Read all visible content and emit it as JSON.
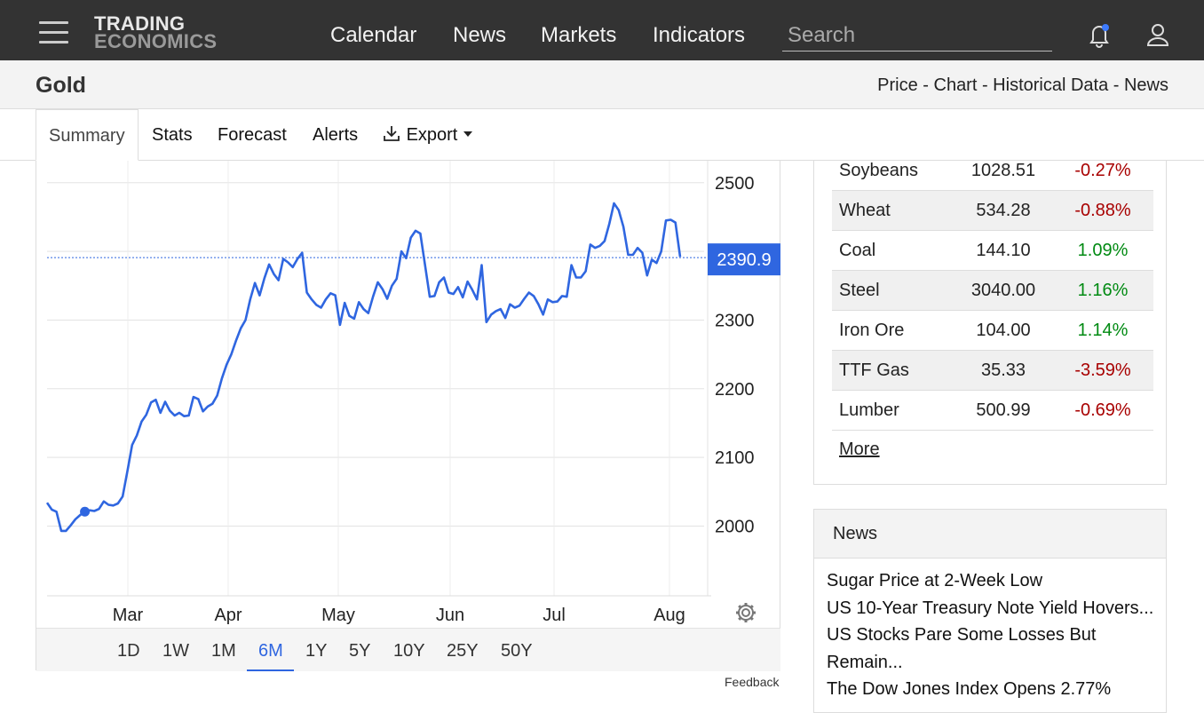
{
  "header": {
    "logo_line1": "TRADING",
    "logo_line2": "ECONOMICS",
    "nav": [
      "Calendar",
      "News",
      "Markets",
      "Indicators"
    ],
    "search_placeholder": "Search"
  },
  "page": {
    "title": "Gold",
    "breadcrumbs": "Price - Chart - Historical Data - News"
  },
  "tabs": [
    "Summary",
    "Stats",
    "Forecast",
    "Alerts",
    "Export"
  ],
  "chart_data": {
    "type": "line",
    "y_ticks": [
      2000,
      2100,
      2200,
      2300,
      2400,
      2500
    ],
    "x_ticks": [
      "Mar",
      "Apr",
      "May",
      "Jun",
      "Jul",
      "Aug"
    ],
    "ylim": [
      1900,
      2520
    ],
    "current_value": "2390.9",
    "current_numeric": 2390.9,
    "grid": true,
    "series_color": "#2f66e0",
    "series": [
      {
        "values": [
          2034,
          2024,
          2021,
          1993,
          1993,
          2001,
          2010,
          2016,
          2021,
          2023,
          2022,
          2025,
          2036,
          2031,
          2030,
          2033,
          2043,
          2080,
          2118,
          2132,
          2152,
          2162,
          2180,
          2184,
          2165,
          2181,
          2168,
          2161,
          2165,
          2160,
          2161,
          2188,
          2185,
          2167,
          2174,
          2178,
          2190,
          2215,
          2235,
          2250,
          2270,
          2288,
          2300,
          2330,
          2354,
          2336,
          2361,
          2381,
          2367,
          2358,
          2389,
          2384,
          2377,
          2389,
          2398,
          2340,
          2330,
          2322,
          2318,
          2330,
          2339,
          2336,
          2293,
          2325,
          2306,
          2302,
          2326,
          2316,
          2310,
          2334,
          2355,
          2345,
          2331,
          2350,
          2360,
          2400,
          2390,
          2420,
          2430,
          2426,
          2380,
          2334,
          2335,
          2355,
          2362,
          2340,
          2338,
          2348,
          2333,
          2356,
          2344,
          2330,
          2380,
          2297,
          2308,
          2313,
          2316,
          2303,
          2323,
          2318,
          2321,
          2331,
          2340,
          2335,
          2323,
          2308,
          2330,
          2326,
          2327,
          2335,
          2334,
          2380,
          2362,
          2362,
          2371,
          2410,
          2405,
          2408,
          2415,
          2440,
          2470,
          2460,
          2436,
          2395,
          2395,
          2405,
          2398,
          2365,
          2388,
          2383,
          2400,
          2445,
          2446,
          2442,
          2392
        ]
      }
    ]
  },
  "ranges": [
    "1D",
    "1W",
    "1M",
    "6M",
    "1Y",
    "5Y",
    "10Y",
    "25Y",
    "50Y"
  ],
  "active_range": "6M",
  "feedback": "Feedback",
  "commodities": [
    {
      "name": "Soybeans",
      "price": "1028.51",
      "change": "-0.27%"
    },
    {
      "name": "Wheat",
      "price": "534.28",
      "change": "-0.88%"
    },
    {
      "name": "Coal",
      "price": "144.10",
      "change": "1.09%"
    },
    {
      "name": "Steel",
      "price": "3040.00",
      "change": "1.16%"
    },
    {
      "name": "Iron Ore",
      "price": "104.00",
      "change": "1.14%"
    },
    {
      "name": "TTF Gas",
      "price": "35.33",
      "change": "-3.59%"
    },
    {
      "name": "Lumber",
      "price": "500.99",
      "change": "-0.69%"
    }
  ],
  "more_label": "More",
  "news": {
    "heading": "News",
    "items": [
      "Sugar Price at 2-Week Low",
      "US 10-Year Treasury Note Yield Hovers...",
      "US Stocks Pare Some Losses But Remain...",
      "The Dow Jones Index Opens 2.77%"
    ]
  },
  "colors": {
    "accent": "#2f66e0",
    "negative": "#a80000",
    "positive": "#008a12",
    "topbar": "#333333"
  }
}
